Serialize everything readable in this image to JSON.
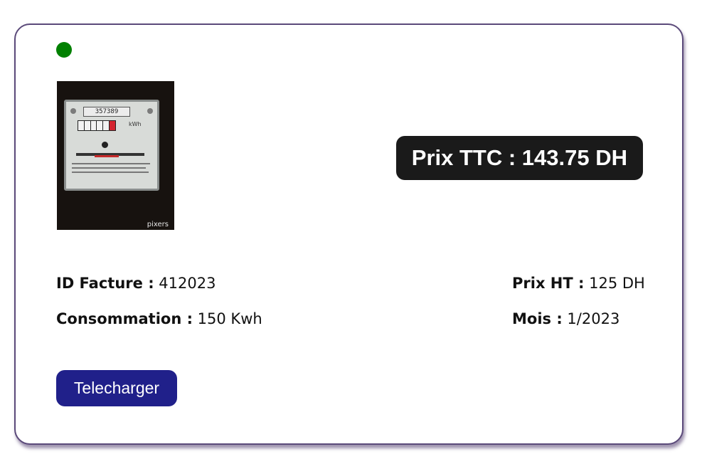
{
  "status": {
    "color": "#008000"
  },
  "invoice": {
    "image_watermark": "pixers",
    "meter_reading": "357389",
    "meter_unit": "kWh",
    "price_ttc": "Prix TTC : 143.75 DH",
    "id_label": "ID Facture :",
    "id_value": "412023",
    "consumption_label": "Consommation :",
    "consumption_value": "150 Kwh",
    "price_ht_label": "Prix HT :",
    "price_ht_value": "125 DH",
    "month_label": "Mois :",
    "month_value": "1/2023"
  },
  "actions": {
    "download_label": "Telecharger",
    "download_color": "#20208a"
  },
  "colors": {
    "card_border": "#5b4a7a",
    "badge_background": "#1a1a1a"
  }
}
